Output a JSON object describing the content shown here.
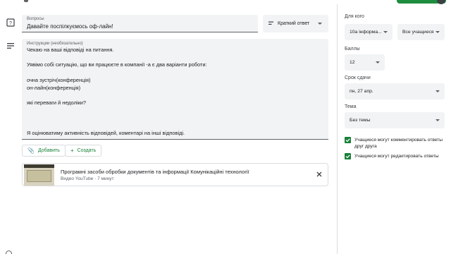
{
  "title_field": {
    "label": "Вопросы",
    "value": "Давайте поспілкуємось оф-лайн!"
  },
  "answer_type": {
    "icon": "short-text-icon",
    "label": "Краткий ответ"
  },
  "instructions": {
    "label": "Инструкции (необязательно)",
    "lines": [
      "Чекаю на ваші відповіді на питання.",
      "Уявімо собі ситуацію, що  ви працюєте в компанії -а  є два варіанти роботи:",
      "очна зустріч(конференція)",
      "он-лайн(конференція)",
      "які переваги й недоліки?",
      "Я оцінюватиму активність  відповідей, коментарі на інші відповіді."
    ]
  },
  "buttons": {
    "add_label": "Добавить",
    "create_label": "Создать"
  },
  "attachment": {
    "title": "Програмні засоби обробки документів та інформації Комунікаційні технології",
    "subtitle": "Видео YouTube · 7 минут"
  },
  "right_panel": {
    "for_whom_label": "Для кого",
    "class_value": "10а інформа...",
    "students_value": "Все учащиеся",
    "points_label": "Баллы",
    "points_value": "12",
    "due_label": "Срок сдачи",
    "due_value": "пн, 27 апр.",
    "topic_label": "Тема",
    "topic_value": "Без темы",
    "checkbox_comment": "Учащиеся могут комментировать ответы друг друга",
    "checkbox_edit": "Учащиеся могут редактировать ответы",
    "accent_color": "#188038"
  }
}
